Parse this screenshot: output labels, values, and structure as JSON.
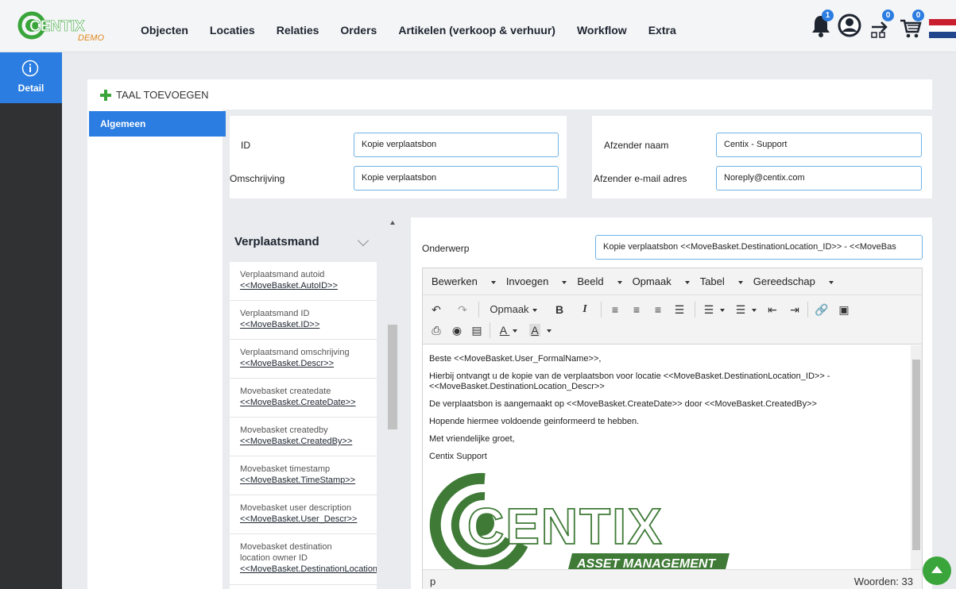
{
  "brand": {
    "logo_text": "CENTIX",
    "tag": "DEMO",
    "accent": "#2b7de1",
    "green": "#3aa53a"
  },
  "nav": [
    "Objecten",
    "Locaties",
    "Relaties",
    "Orders",
    "Artikelen (verkoop & verhuur)",
    "Workflow",
    "Extra"
  ],
  "top_icons": {
    "notifications_count": "1",
    "workflow_count": "0",
    "cart_count": "0",
    "icons": [
      "bell-icon",
      "user-avatar-icon",
      "tasks-icon",
      "cart-icon",
      "flag-nl-icon"
    ]
  },
  "rail": {
    "detail_label": "Detail"
  },
  "actions": {
    "add_language": "TAAL TOEVOEGEN"
  },
  "side_menu": {
    "active": "Algemeen"
  },
  "form_left": {
    "id_label": "ID",
    "id_value": "Kopie verplaatsbon",
    "descr_label": "Omschrijving",
    "descr_value": "Kopie verplaatsbon"
  },
  "form_right": {
    "sender_name_label": "Afzender naam",
    "sender_name_value": "Centix - Support",
    "sender_email_label": "Afzender e-mail adres",
    "sender_email_value": "Noreply@centix.com"
  },
  "variables": {
    "title": "Verplaatsmand",
    "items": [
      {
        "label": "Verplaatsmand autoid",
        "code": "<<MoveBasket.AutoID>>"
      },
      {
        "label": "Verplaatsmand ID",
        "code": "<<MoveBasket.ID>>"
      },
      {
        "label": "Verplaatsmand omschrijving",
        "code": "<<MoveBasket.Descr>>"
      },
      {
        "label": "Movebasket createdate",
        "code": "<<MoveBasket.CreateDate>>"
      },
      {
        "label": "Movebasket createdby",
        "code": "<<MoveBasket.CreatedBy>>"
      },
      {
        "label": "Movebasket timestamp",
        "code": "<<MoveBasket.TimeStamp>>"
      },
      {
        "label": "Movebasket user description",
        "code": "<<MoveBasket.User_Descr>>"
      },
      {
        "label": "Movebasket destination location owner ID",
        "code": "<<MoveBasket.DestinationLocationO"
      }
    ]
  },
  "mail": {
    "subject_label": "Onderwerp",
    "subject_value": "Kopie verplaatsbon <<MoveBasket.DestinationLocation_ID>> - <<MoveBas",
    "menu": [
      "Bewerken",
      "Invoegen",
      "Beeld",
      "Opmaak",
      "Tabel",
      "Gereedschap"
    ],
    "format_label": "Opmaak",
    "body": [
      "Beste <<MoveBasket.User_FormalName>>,",
      "Hierbij ontvangt u de kopie van de verplaatsbon voor locatie <<MoveBasket.DestinationLocation_ID>> - <<MoveBasket.DestinationLocation_Descr>>",
      "De verplaatsbon is aangemaakt op <<MoveBasket.CreateDate>> door <<MoveBasket.CreatedBy>>",
      "Hopende hiermee voldoende geinformeerd te hebben.",
      "Met vriendelijke groet,",
      "Centix Support"
    ],
    "signature_logo": "CENTIX",
    "signature_tagline": "ASSET MANAGEMENT",
    "path": "p",
    "word_count": "Woorden: 33"
  }
}
